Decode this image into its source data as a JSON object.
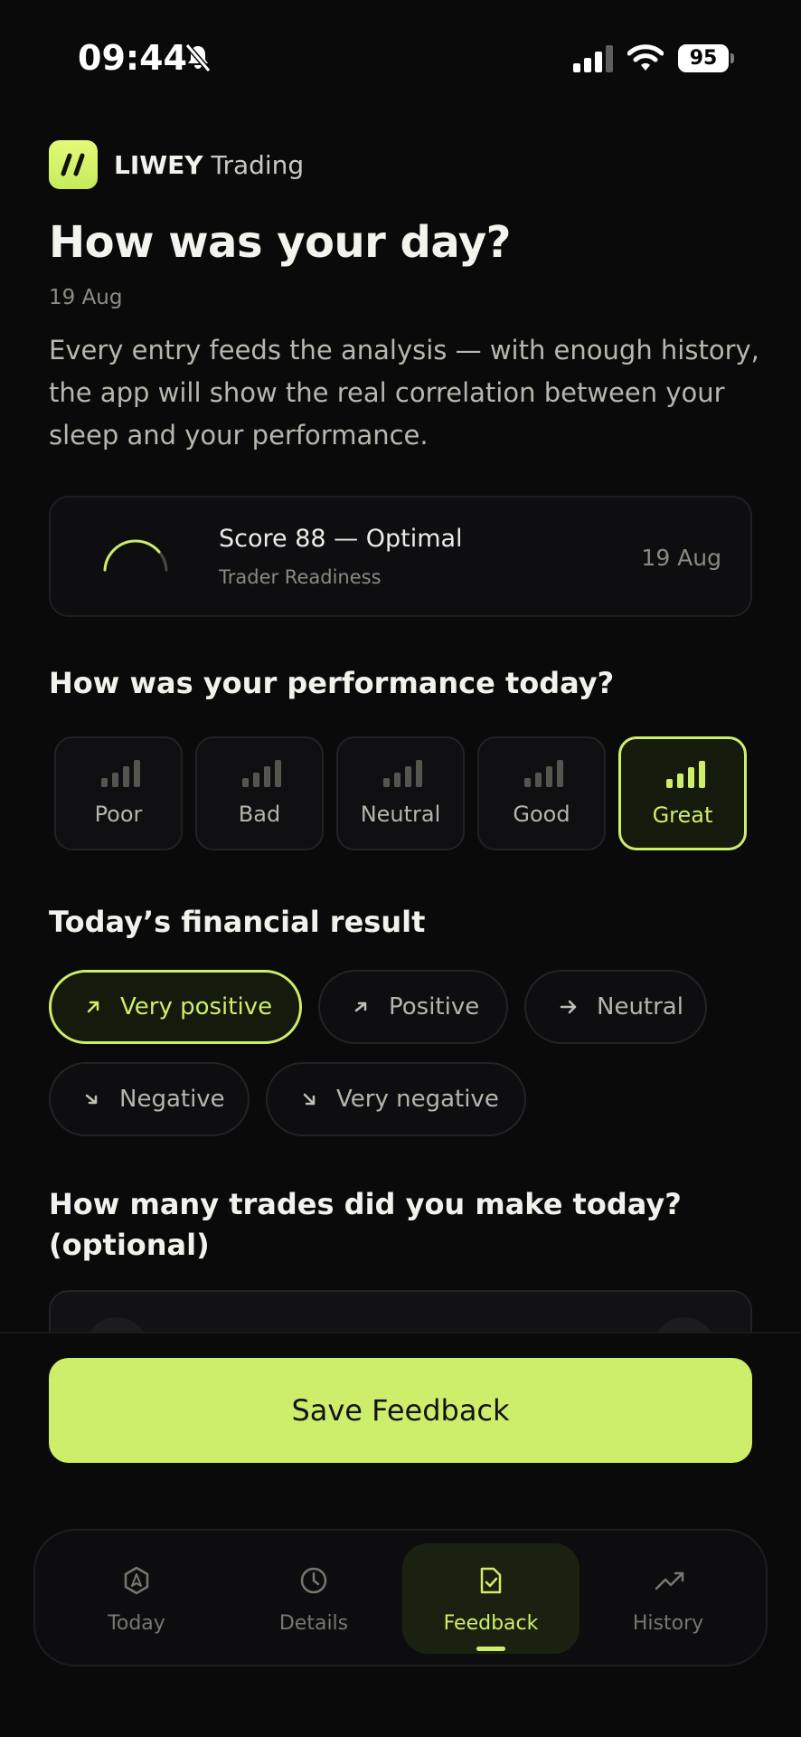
{
  "status_bar": {
    "time": "09:44",
    "battery": "95"
  },
  "brand": {
    "name": "LIWEY",
    "suffix": "Trading"
  },
  "header": {
    "title": "How was your day?",
    "date": "19 Aug",
    "intro": "Every entry feeds the analysis — with enough history, the app will show the real correlation between your sleep and your performance."
  },
  "score_card": {
    "title": "Score 88 — Optimal",
    "subtitle": "Trader Readiness",
    "date": "19 Aug",
    "score_value": 88
  },
  "performance": {
    "question": "How was your performance today?",
    "options": [
      "Poor",
      "Bad",
      "Neutral",
      "Good",
      "Great"
    ],
    "selected": "Great"
  },
  "financial": {
    "question": "Today’s financial result",
    "options": [
      "Very positive",
      "Positive",
      "Neutral",
      "Negative",
      "Very negative"
    ],
    "selected": "Very positive"
  },
  "trades": {
    "question_line1": "How many trades did you make today?",
    "question_line2": "(optional)"
  },
  "save_button": "Save Feedback",
  "tabs": [
    {
      "label": "Today",
      "icon": "compass-icon"
    },
    {
      "label": "Details",
      "icon": "clock-icon"
    },
    {
      "label": "Feedback",
      "icon": "feedback-icon"
    },
    {
      "label": "History",
      "icon": "trend-icon"
    }
  ],
  "active_tab": "Feedback",
  "colors": {
    "accent": "#cdee6a",
    "background": "#0a0a0b"
  }
}
